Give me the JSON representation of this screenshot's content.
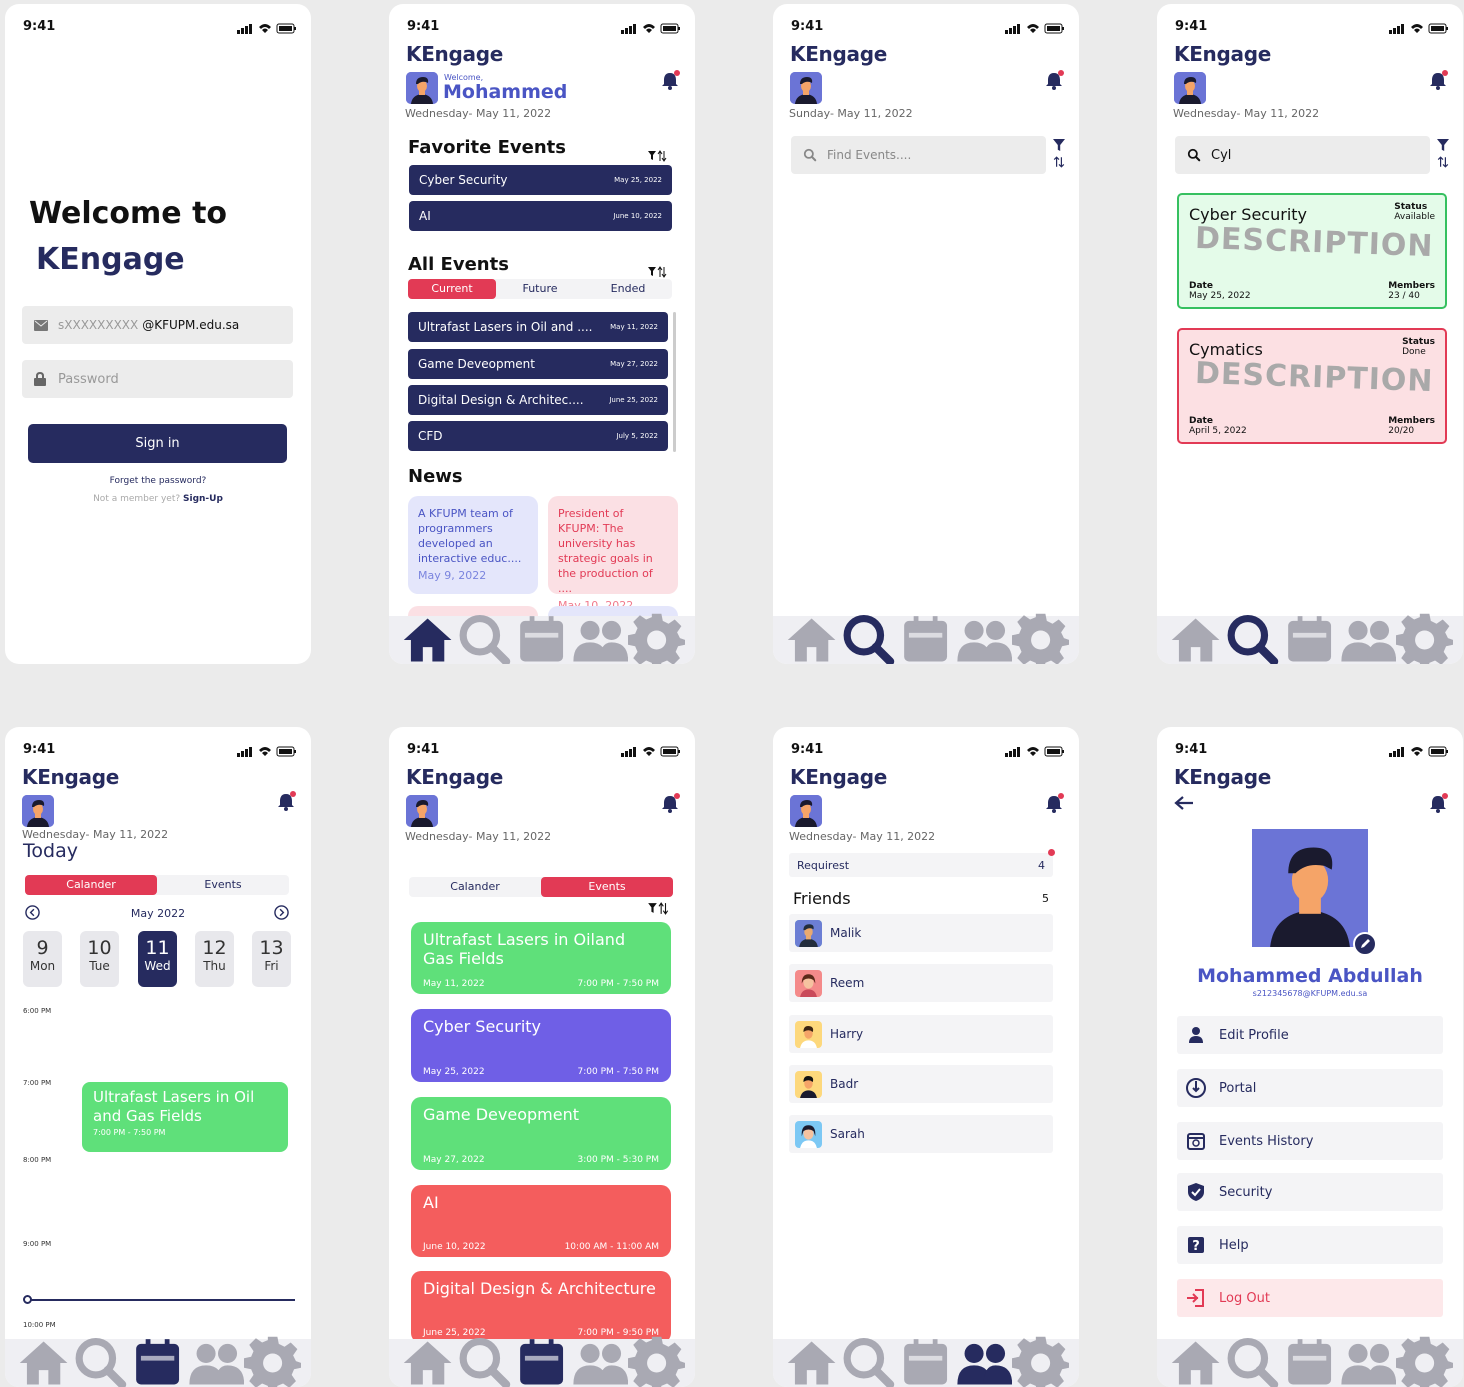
{
  "status_time": "9:41",
  "brand": "KEngage",
  "colors": {
    "navy": "#262b5f",
    "red": "#e23a55",
    "green": "#5fe07a",
    "purple": "#6f5fe6",
    "coral": "#f45d5d"
  },
  "login": {
    "welcome_line1": "Welcome to",
    "welcome_line2": "KEngage",
    "email_placeholder": "sXXXXXXXXX",
    "email_domain": "@KFUPM.edu.sa",
    "password_placeholder": "Password",
    "sign_in": "Sign in",
    "forgot": "Forget the password?",
    "not_member": "Not a member yet?",
    "sign_up": "Sign-Up"
  },
  "home": {
    "welcome": "Welcome,",
    "user_name": "Mohammed",
    "date": "Wednesday- May 11, 2022",
    "favorite_title": "Favorite Events",
    "favorites": [
      {
        "name": "Cyber Security",
        "date": "May 25, 2022"
      },
      {
        "name": "AI",
        "date": "June 10, 2022"
      }
    ],
    "all_title": "All Events",
    "tabs": [
      "Current",
      "Future",
      "Ended"
    ],
    "events": [
      {
        "name": "Ultrafast Lasers in Oil and ....",
        "date": "May 11, 2022"
      },
      {
        "name": "Game Deveopment",
        "date": "May 27, 2022"
      },
      {
        "name": "Digital Design & Architec....",
        "date": "June 25, 2022"
      },
      {
        "name": "CFD",
        "date": "July 5, 2022"
      }
    ],
    "news_title": "News",
    "news": [
      {
        "text": "A KFUPM team of programmers developed an interactive educ....",
        "date": "May 9, 2022"
      },
      {
        "text": "President of KFUPM: The university has strategic goals in the production of ....",
        "date": "May 10, 2022"
      }
    ]
  },
  "search_empty": {
    "date": "Sunday- May 11, 2022",
    "placeholder": "Find Events...."
  },
  "search_results": {
    "date": "Wednesday- May 11, 2022",
    "query": "Cyl",
    "results": [
      {
        "title": "Cyber Security",
        "status_label": "Status",
        "status": "Available",
        "desc": "DESCRIPTION",
        "date_label": "Date",
        "date": "May 25, 2022",
        "members_label": "Members",
        "members": "23 / 40"
      },
      {
        "title": "Cymatics",
        "status_label": "Status",
        "status": "Done",
        "desc": "DESCRIPTION",
        "date_label": "Date",
        "date": "April 5, 2022",
        "members_label": "Members",
        "members": "20/20"
      }
    ]
  },
  "calendar": {
    "date": "Wednesday- May 11, 2022",
    "today": "Today",
    "tabs": [
      "Calander",
      "Events"
    ],
    "month": "May 2022",
    "days": [
      {
        "n": "9",
        "w": "Mon"
      },
      {
        "n": "10",
        "w": "Tue"
      },
      {
        "n": "11",
        "w": "Wed"
      },
      {
        "n": "12",
        "w": "Thu"
      },
      {
        "n": "13",
        "w": "Fri"
      }
    ],
    "times": [
      "6:00 PM",
      "7:00 PM",
      "8:00 PM",
      "9:00 PM",
      "10:00 PM"
    ],
    "event": {
      "title": "Ultrafast Lasers in Oil and Gas Fields",
      "time": "7:00 PM - 7:50 PM"
    }
  },
  "events_list": {
    "date": "Wednesday- May 11, 2022",
    "tabs": [
      "Calander",
      "Events"
    ],
    "cards": [
      {
        "title": "Ultrafast Lasers in Oiland Gas Fields",
        "date": "May 11, 2022",
        "time": "7:00 PM - 7:50 PM"
      },
      {
        "title": "Cyber Security",
        "date": "May 25, 2022",
        "time": "7:00 PM - 7:50 PM"
      },
      {
        "title": "Game Deveopment",
        "date": "May 27, 2022",
        "time": "3:00 PM - 5:30 PM"
      },
      {
        "title": "AI",
        "date": "June 10, 2022",
        "time": "10:00 AM - 11:00 AM"
      },
      {
        "title": "Digital Design & Architecture",
        "date": "June 25, 2022",
        "time": "7:00 PM - 9:50 PM"
      }
    ]
  },
  "friends": {
    "date": "Wednesday- May 11, 2022",
    "requests_label": "Requirest",
    "requests_count": "4",
    "friends_label": "Friends",
    "friends_count": "5",
    "list": [
      "Malik",
      "Reem",
      "Harry",
      "Badr",
      "Sarah"
    ]
  },
  "profile": {
    "name": "Mohammed Abdullah",
    "email": "s212345678@KFUPM.edu.sa",
    "menu": [
      "Edit Profile",
      "Portal",
      "Events History",
      "Security",
      "Help",
      "Log Out"
    ]
  }
}
